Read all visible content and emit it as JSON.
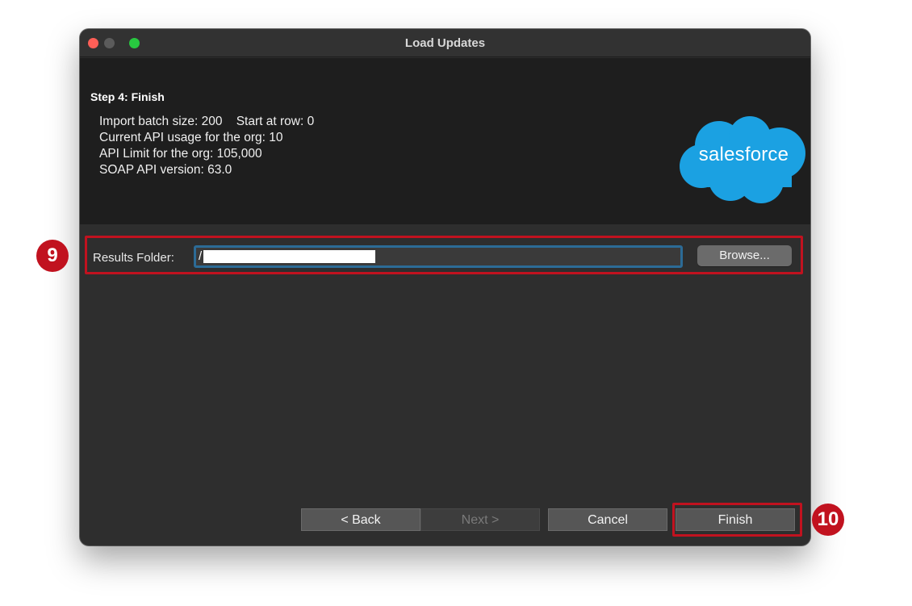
{
  "window": {
    "title": "Load Updates",
    "traffic_lights": [
      "close",
      "minimize",
      "maximize"
    ]
  },
  "header": {
    "step_title": "Step 4: Finish",
    "info_lines": [
      "Import batch size: 200    Start at row: 0",
      "Current API usage for the org: 10",
      "API Limit for the org: 105,000",
      "SOAP API version: 63.0"
    ],
    "logo_text": "salesforce",
    "logo_color": "#1ba1e2"
  },
  "results": {
    "label": "Results Folder:",
    "folder_value": "/",
    "browse_label": "Browse..."
  },
  "buttons": {
    "back": "< Back",
    "next": "Next >",
    "cancel": "Cancel",
    "finish": "Finish"
  },
  "annotations": {
    "badge_9": "9",
    "badge_10": "10",
    "color": "#c1121f"
  }
}
